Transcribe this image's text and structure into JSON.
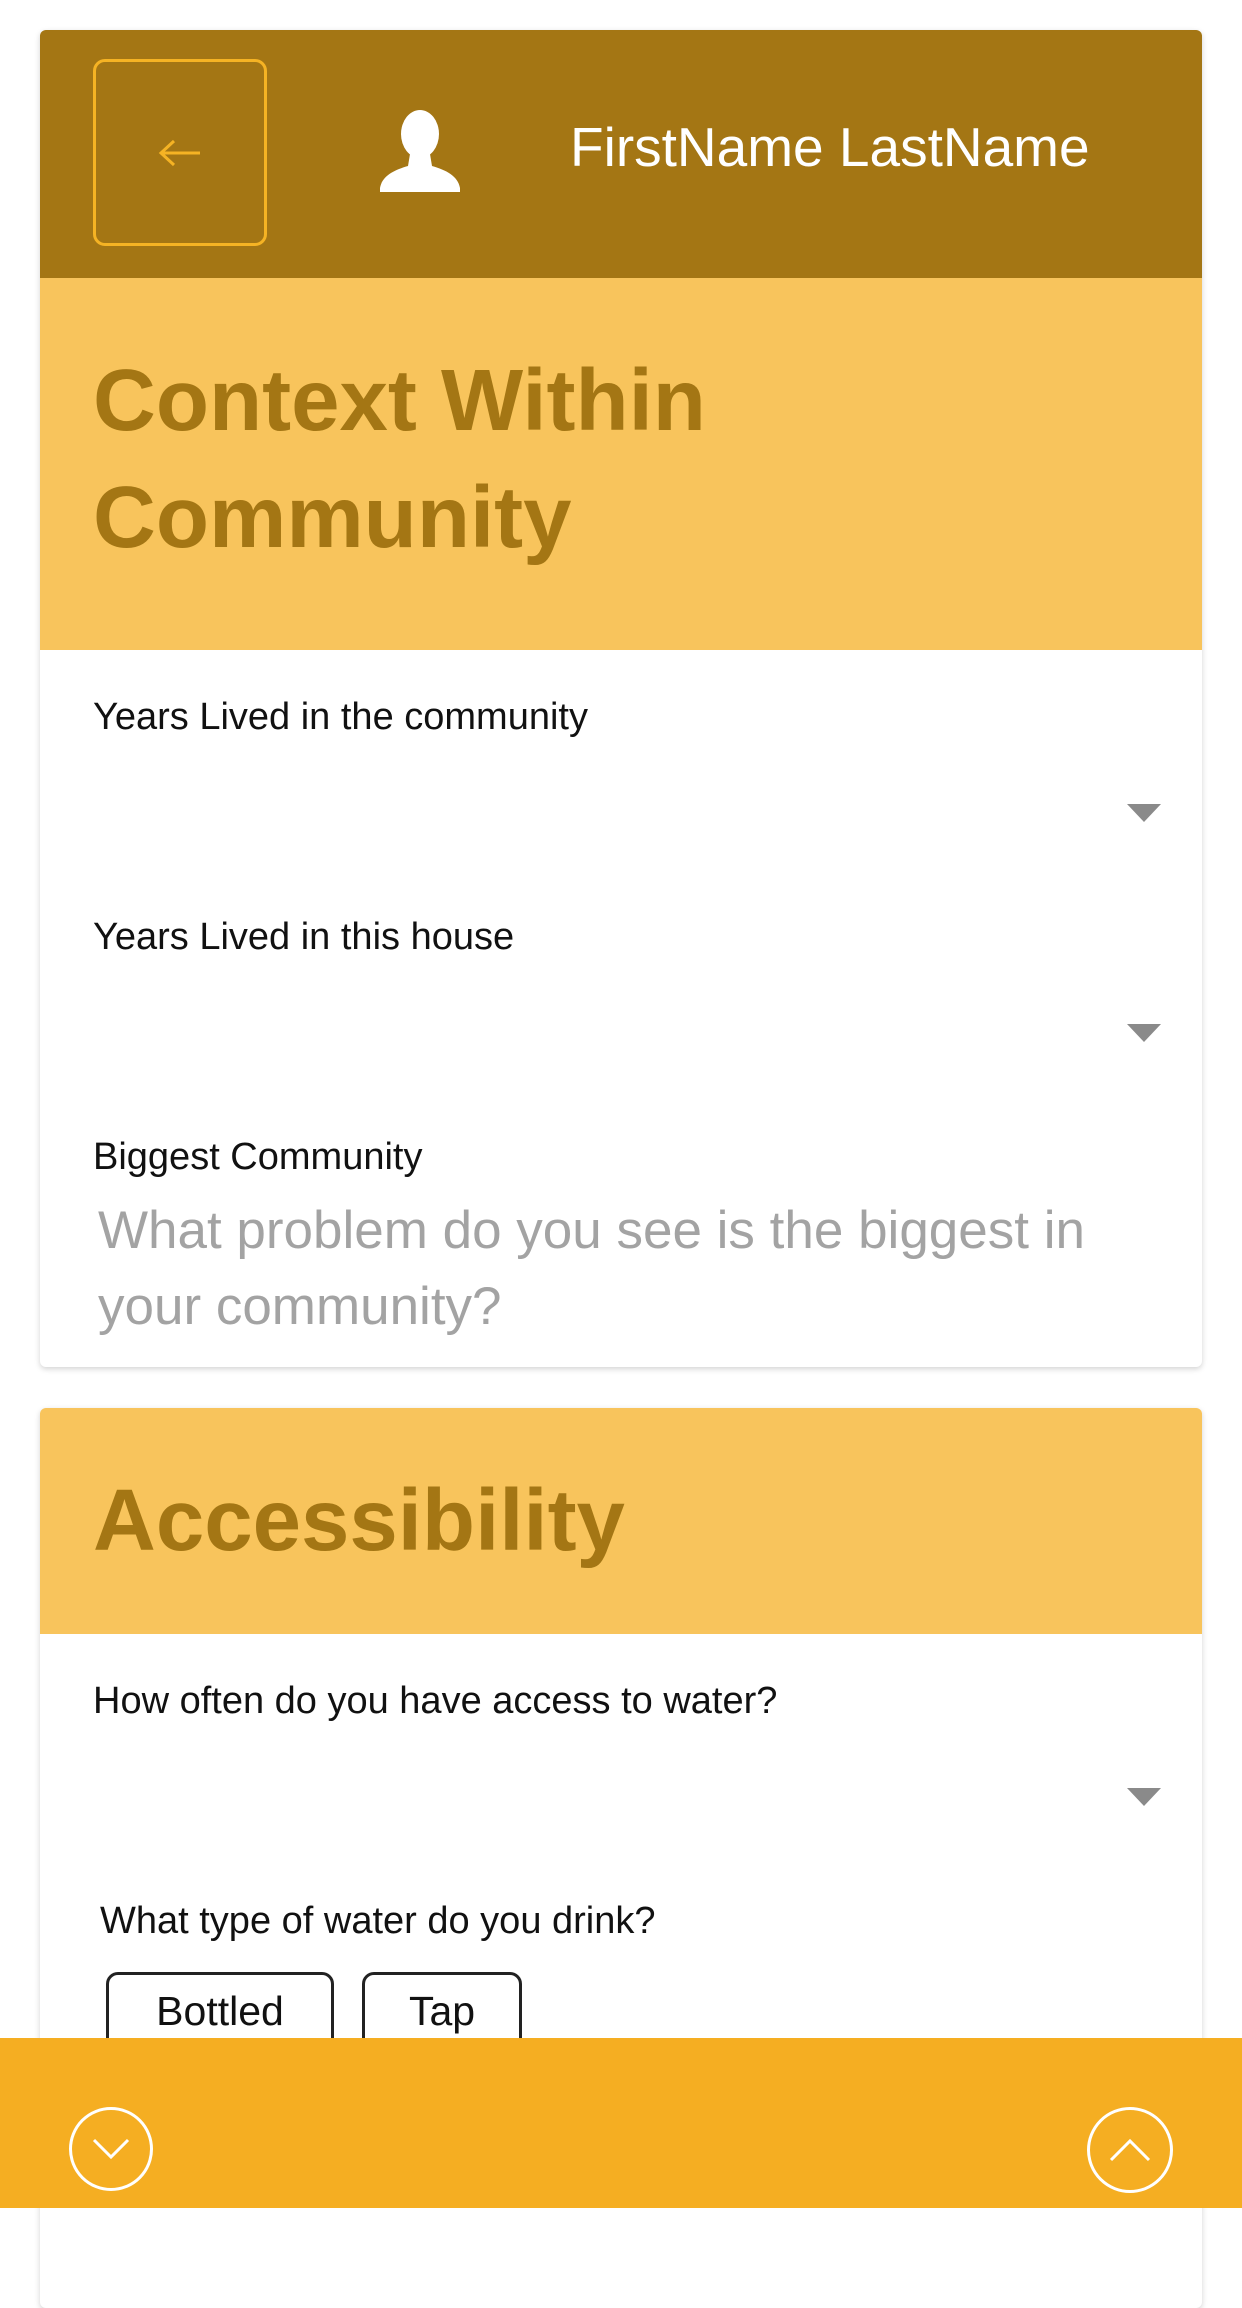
{
  "header": {
    "back_icon": "arrow-left-icon",
    "avatar_icon": "user-silhouette-icon",
    "user_name": "FirstName LastName",
    "accent_color": "#f5b324",
    "bar_color": "#a47614"
  },
  "sections": {
    "context": {
      "title_line1": "Context Within",
      "title_line2": "Community",
      "fields": {
        "years_community_label": "Years Lived in the community",
        "years_house_label": "Years Lived in this house",
        "biggest_community_label": "Biggest Community",
        "biggest_community_placeholder": "What problem do you see is the biggest in your community?"
      }
    },
    "accessibility": {
      "title": "Accessibility",
      "fields": {
        "water_access_label": "How often do you have access to water?",
        "water_type_label": "What type of water do you drink?",
        "water_type_options": [
          "Bottled",
          "Tap"
        ]
      }
    }
  },
  "footer": {
    "down_icon": "chevron-down-circle-icon",
    "up_icon": "chevron-up-circle-icon",
    "bar_color": "#f5ae22"
  }
}
